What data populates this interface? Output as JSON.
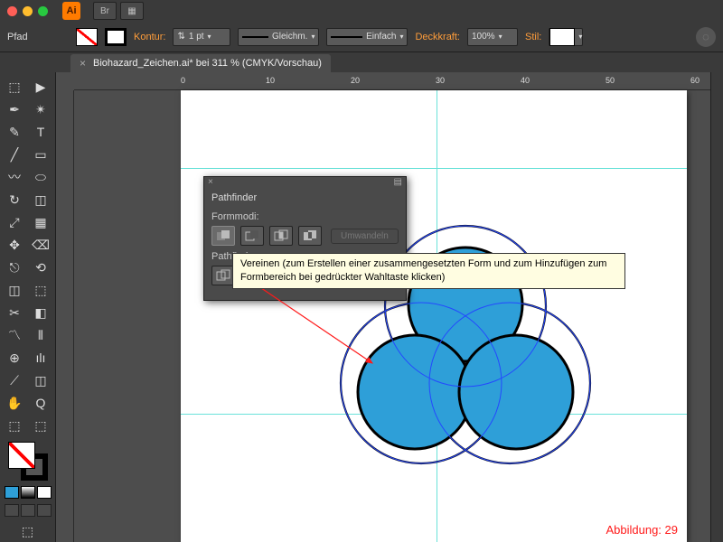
{
  "app_name": "Ai",
  "controlbar": {
    "path": "Pfad",
    "stroke_label": "Kontur:",
    "stroke_weight": "1 pt",
    "dash_label1": "Gleichm.",
    "dash_label2": "Einfach",
    "opacity_label": "Deckkraft:",
    "opacity_value": "100%",
    "style_label": "Stil:"
  },
  "doc_tab": "Biohazard_Zeichen.ai* bei 311 % (CMYK/Vorschau)",
  "ruler_ticks": [
    "0",
    "10",
    "20",
    "30",
    "40",
    "50",
    "60"
  ],
  "panel": {
    "title": "Pathfinder",
    "shape_modes": "Formmodi:",
    "convert": "Umwandeln",
    "pathfinders": "Pathfinder:"
  },
  "tooltip": "Vereinen (zum Erstellen einer zusammengesetzten Form und zum Hinzufügen zum Formbereich bei gedrückter Wahltaste klicken)",
  "figure_label": "Abbildung: 29",
  "tools_glyphs": [
    "⬚",
    "▶",
    "✒",
    "✴",
    "✎",
    "T",
    "╱",
    "▭",
    "〰",
    "⬭",
    "↻",
    "◫",
    "⤢",
    "▦",
    "✥",
    "⌫",
    "⎋",
    "⟲",
    "◫",
    "⬚",
    "✂",
    "◧",
    "〽",
    "⫴",
    "⊕",
    "ılı",
    "⟋",
    "◫",
    "✋",
    "Q",
    "⬚",
    "⬚"
  ],
  "colors": {
    "circle_fill": "#2e9fd8",
    "guide": "#6ae2d9",
    "accent": "#ff9d3a"
  }
}
